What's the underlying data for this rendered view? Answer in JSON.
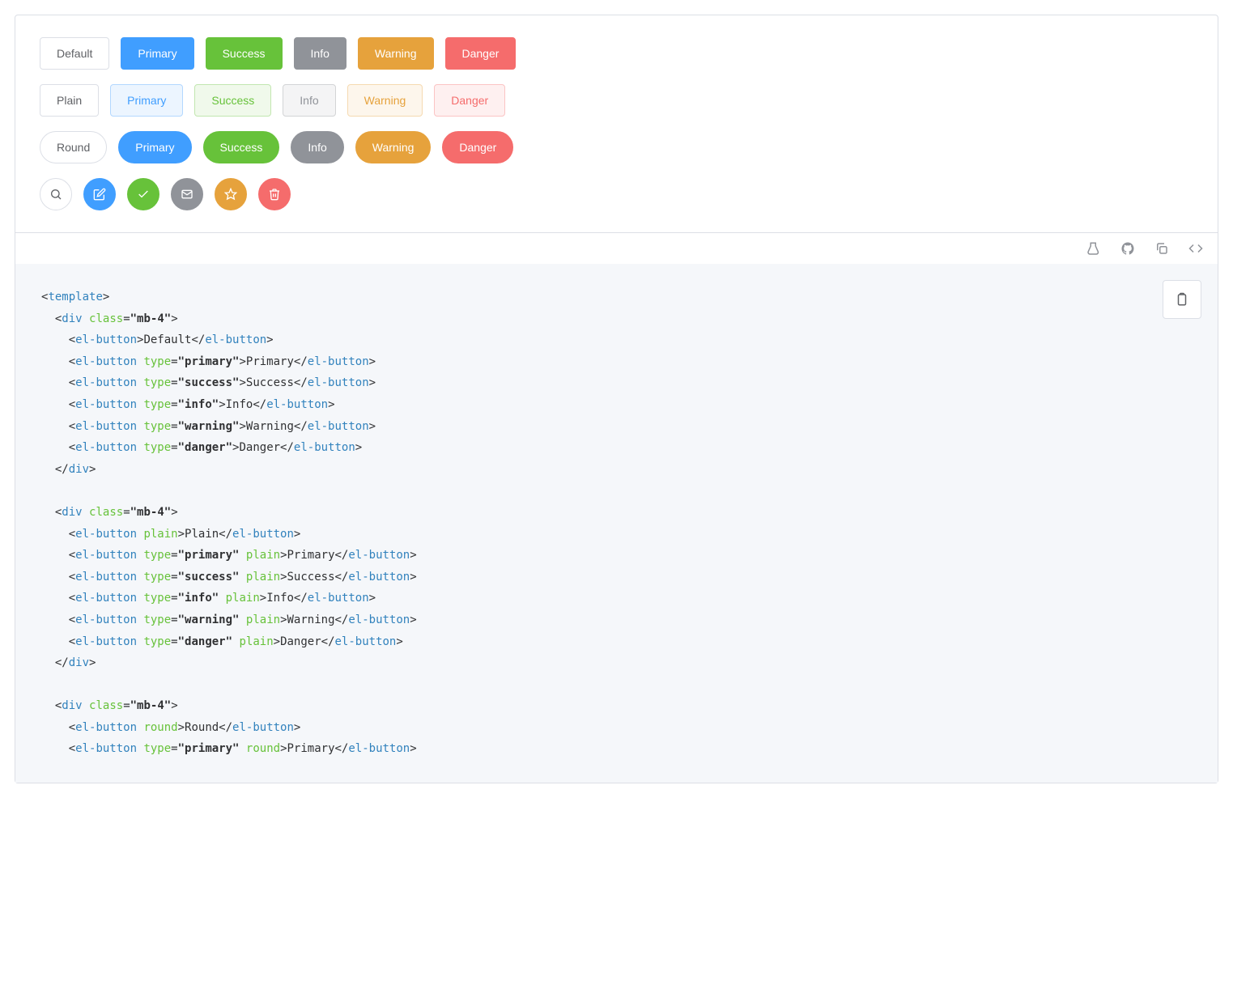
{
  "rows": {
    "solid": {
      "default": "Default",
      "primary": "Primary",
      "success": "Success",
      "info": "Info",
      "warning": "Warning",
      "danger": "Danger"
    },
    "plain": {
      "default": "Plain",
      "primary": "Primary",
      "success": "Success",
      "info": "Info",
      "warning": "Warning",
      "danger": "Danger"
    },
    "round": {
      "default": "Round",
      "primary": "Primary",
      "success": "Success",
      "info": "Info",
      "warning": "Warning",
      "danger": "Danger"
    },
    "icons": {
      "search": "search-icon",
      "edit": "edit-icon",
      "check": "check-icon",
      "mail": "mail-icon",
      "star": "star-icon",
      "delete": "delete-icon"
    }
  },
  "toolbar": {
    "playground": "playground-icon",
    "github": "github-icon",
    "copy": "copy-icon",
    "code": "code-toggle-icon"
  },
  "code_lines": [
    [
      [
        "punct",
        "<"
      ],
      [
        "tag",
        "template"
      ],
      [
        "punct",
        ">"
      ]
    ],
    [
      [
        "punct",
        "  <"
      ],
      [
        "tag",
        "div"
      ],
      [
        "punct",
        " "
      ],
      [
        "attr",
        "class"
      ],
      [
        "punct",
        "="
      ],
      [
        "str",
        "\"mb-4\""
      ],
      [
        "punct",
        ">"
      ]
    ],
    [
      [
        "punct",
        "    <"
      ],
      [
        "tag",
        "el-button"
      ],
      [
        "punct",
        ">Default</"
      ],
      [
        "tag",
        "el-button"
      ],
      [
        "punct",
        ">"
      ]
    ],
    [
      [
        "punct",
        "    <"
      ],
      [
        "tag",
        "el-button"
      ],
      [
        "punct",
        " "
      ],
      [
        "attr",
        "type"
      ],
      [
        "punct",
        "="
      ],
      [
        "str",
        "\"primary\""
      ],
      [
        "punct",
        ">Primary</"
      ],
      [
        "tag",
        "el-button"
      ],
      [
        "punct",
        ">"
      ]
    ],
    [
      [
        "punct",
        "    <"
      ],
      [
        "tag",
        "el-button"
      ],
      [
        "punct",
        " "
      ],
      [
        "attr",
        "type"
      ],
      [
        "punct",
        "="
      ],
      [
        "str",
        "\"success\""
      ],
      [
        "punct",
        ">Success</"
      ],
      [
        "tag",
        "el-button"
      ],
      [
        "punct",
        ">"
      ]
    ],
    [
      [
        "punct",
        "    <"
      ],
      [
        "tag",
        "el-button"
      ],
      [
        "punct",
        " "
      ],
      [
        "attr",
        "type"
      ],
      [
        "punct",
        "="
      ],
      [
        "str",
        "\"info\""
      ],
      [
        "punct",
        ">Info</"
      ],
      [
        "tag",
        "el-button"
      ],
      [
        "punct",
        ">"
      ]
    ],
    [
      [
        "punct",
        "    <"
      ],
      [
        "tag",
        "el-button"
      ],
      [
        "punct",
        " "
      ],
      [
        "attr",
        "type"
      ],
      [
        "punct",
        "="
      ],
      [
        "str",
        "\"warning\""
      ],
      [
        "punct",
        ">Warning</"
      ],
      [
        "tag",
        "el-button"
      ],
      [
        "punct",
        ">"
      ]
    ],
    [
      [
        "punct",
        "    <"
      ],
      [
        "tag",
        "el-button"
      ],
      [
        "punct",
        " "
      ],
      [
        "attr",
        "type"
      ],
      [
        "punct",
        "="
      ],
      [
        "str",
        "\"danger\""
      ],
      [
        "punct",
        ">Danger</"
      ],
      [
        "tag",
        "el-button"
      ],
      [
        "punct",
        ">"
      ]
    ],
    [
      [
        "punct",
        "  </"
      ],
      [
        "tag",
        "div"
      ],
      [
        "punct",
        ">"
      ]
    ],
    [],
    [
      [
        "punct",
        "  <"
      ],
      [
        "tag",
        "div"
      ],
      [
        "punct",
        " "
      ],
      [
        "attr",
        "class"
      ],
      [
        "punct",
        "="
      ],
      [
        "str",
        "\"mb-4\""
      ],
      [
        "punct",
        ">"
      ]
    ],
    [
      [
        "punct",
        "    <"
      ],
      [
        "tag",
        "el-button"
      ],
      [
        "punct",
        " "
      ],
      [
        "attr",
        "plain"
      ],
      [
        "punct",
        ">Plain</"
      ],
      [
        "tag",
        "el-button"
      ],
      [
        "punct",
        ">"
      ]
    ],
    [
      [
        "punct",
        "    <"
      ],
      [
        "tag",
        "el-button"
      ],
      [
        "punct",
        " "
      ],
      [
        "attr",
        "type"
      ],
      [
        "punct",
        "="
      ],
      [
        "str",
        "\"primary\""
      ],
      [
        "punct",
        " "
      ],
      [
        "attr",
        "plain"
      ],
      [
        "punct",
        ">Primary</"
      ],
      [
        "tag",
        "el-button"
      ],
      [
        "punct",
        ">"
      ]
    ],
    [
      [
        "punct",
        "    <"
      ],
      [
        "tag",
        "el-button"
      ],
      [
        "punct",
        " "
      ],
      [
        "attr",
        "type"
      ],
      [
        "punct",
        "="
      ],
      [
        "str",
        "\"success\""
      ],
      [
        "punct",
        " "
      ],
      [
        "attr",
        "plain"
      ],
      [
        "punct",
        ">Success</"
      ],
      [
        "tag",
        "el-button"
      ],
      [
        "punct",
        ">"
      ]
    ],
    [
      [
        "punct",
        "    <"
      ],
      [
        "tag",
        "el-button"
      ],
      [
        "punct",
        " "
      ],
      [
        "attr",
        "type"
      ],
      [
        "punct",
        "="
      ],
      [
        "str",
        "\"info\""
      ],
      [
        "punct",
        " "
      ],
      [
        "attr",
        "plain"
      ],
      [
        "punct",
        ">Info</"
      ],
      [
        "tag",
        "el-button"
      ],
      [
        "punct",
        ">"
      ]
    ],
    [
      [
        "punct",
        "    <"
      ],
      [
        "tag",
        "el-button"
      ],
      [
        "punct",
        " "
      ],
      [
        "attr",
        "type"
      ],
      [
        "punct",
        "="
      ],
      [
        "str",
        "\"warning\""
      ],
      [
        "punct",
        " "
      ],
      [
        "attr",
        "plain"
      ],
      [
        "punct",
        ">Warning</"
      ],
      [
        "tag",
        "el-button"
      ],
      [
        "punct",
        ">"
      ]
    ],
    [
      [
        "punct",
        "    <"
      ],
      [
        "tag",
        "el-button"
      ],
      [
        "punct",
        " "
      ],
      [
        "attr",
        "type"
      ],
      [
        "punct",
        "="
      ],
      [
        "str",
        "\"danger\""
      ],
      [
        "punct",
        " "
      ],
      [
        "attr",
        "plain"
      ],
      [
        "punct",
        ">Danger</"
      ],
      [
        "tag",
        "el-button"
      ],
      [
        "punct",
        ">"
      ]
    ],
    [
      [
        "punct",
        "  </"
      ],
      [
        "tag",
        "div"
      ],
      [
        "punct",
        ">"
      ]
    ],
    [],
    [
      [
        "punct",
        "  <"
      ],
      [
        "tag",
        "div"
      ],
      [
        "punct",
        " "
      ],
      [
        "attr",
        "class"
      ],
      [
        "punct",
        "="
      ],
      [
        "str",
        "\"mb-4\""
      ],
      [
        "punct",
        ">"
      ]
    ],
    [
      [
        "punct",
        "    <"
      ],
      [
        "tag",
        "el-button"
      ],
      [
        "punct",
        " "
      ],
      [
        "attr",
        "round"
      ],
      [
        "punct",
        ">Round</"
      ],
      [
        "tag",
        "el-button"
      ],
      [
        "punct",
        ">"
      ]
    ],
    [
      [
        "punct",
        "    <"
      ],
      [
        "tag",
        "el-button"
      ],
      [
        "punct",
        " "
      ],
      [
        "attr",
        "type"
      ],
      [
        "punct",
        "="
      ],
      [
        "str",
        "\"primary\""
      ],
      [
        "punct",
        " "
      ],
      [
        "attr",
        "round"
      ],
      [
        "punct",
        ">Primary</"
      ],
      [
        "tag",
        "el-button"
      ],
      [
        "punct",
        ">"
      ]
    ]
  ]
}
